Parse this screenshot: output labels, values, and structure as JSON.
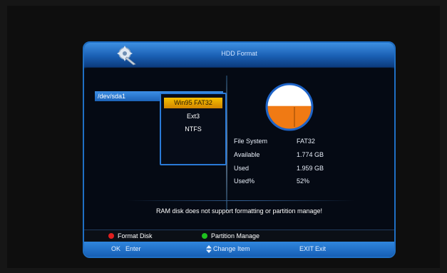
{
  "window": {
    "title": "HDD Format"
  },
  "device": {
    "name": "/dev/sda1"
  },
  "file_system_options": [
    {
      "label": "Win95 FAT32",
      "selected": true
    },
    {
      "label": "Ext3",
      "selected": false
    },
    {
      "label": "NTFS",
      "selected": false
    }
  ],
  "info": {
    "file_system_label": "File System",
    "file_system_value": "FAT32",
    "available_label": "Available",
    "available_value": "1.774 GB",
    "used_label": "Used",
    "used_value": "1.959 GB",
    "used_pct_label": "Used%",
    "used_pct_value": "52%"
  },
  "usage_chart": {
    "used_fraction": 0.52,
    "used_color": "#f07a14",
    "free_color": "#ffffff"
  },
  "notice": "RAM disk does not support formatting or partition manage!",
  "color_keys": {
    "red_label": "Format Disk",
    "green_label": "Partition Manage",
    "red_color": "#e01e1e",
    "green_color": "#1ec01e"
  },
  "keys": {
    "ok_key": "OK",
    "ok_label": "Enter",
    "change_label": "Change Item",
    "exit_key": "EXIT",
    "exit_label": "Exit"
  },
  "colors": {
    "accent": "#1f6fc4",
    "highlight": "#f5c000"
  }
}
